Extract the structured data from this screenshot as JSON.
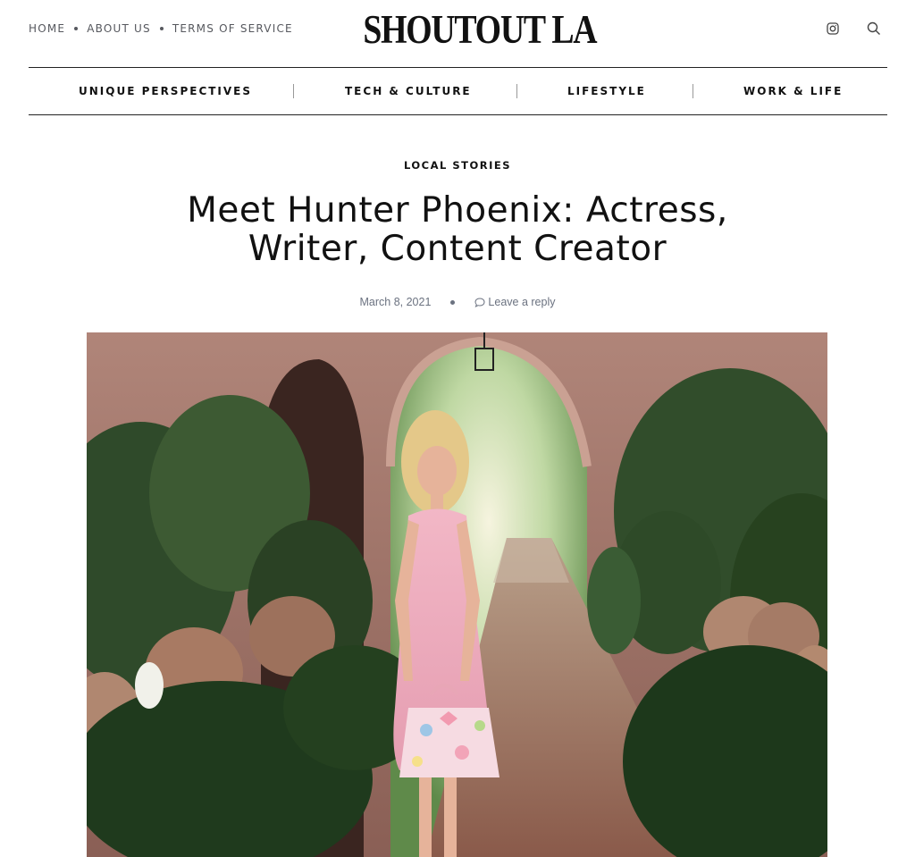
{
  "header": {
    "links": [
      {
        "label": "HOME"
      },
      {
        "label": "ABOUT US"
      },
      {
        "label": "TERMS OF SERVICE"
      }
    ],
    "logo": "SHOUTOUT LA",
    "icons": [
      "instagram-icon",
      "search-icon"
    ]
  },
  "nav": {
    "items": [
      {
        "label": "UNIQUE PERSPECTIVES"
      },
      {
        "label": "TECH & CULTURE"
      },
      {
        "label": "LIFESTYLE"
      },
      {
        "label": "WORK & LIFE"
      }
    ]
  },
  "article": {
    "category": "LOCAL STORIES",
    "title_line1": "Meet Hunter Phoenix: Actress,",
    "title_line2": "Writer, Content Creator",
    "date": "March 8, 2021",
    "reply_label": "Leave a reply"
  },
  "colors": {
    "text": "#111111",
    "muted": "#56585e",
    "meta": "#6b7280"
  }
}
